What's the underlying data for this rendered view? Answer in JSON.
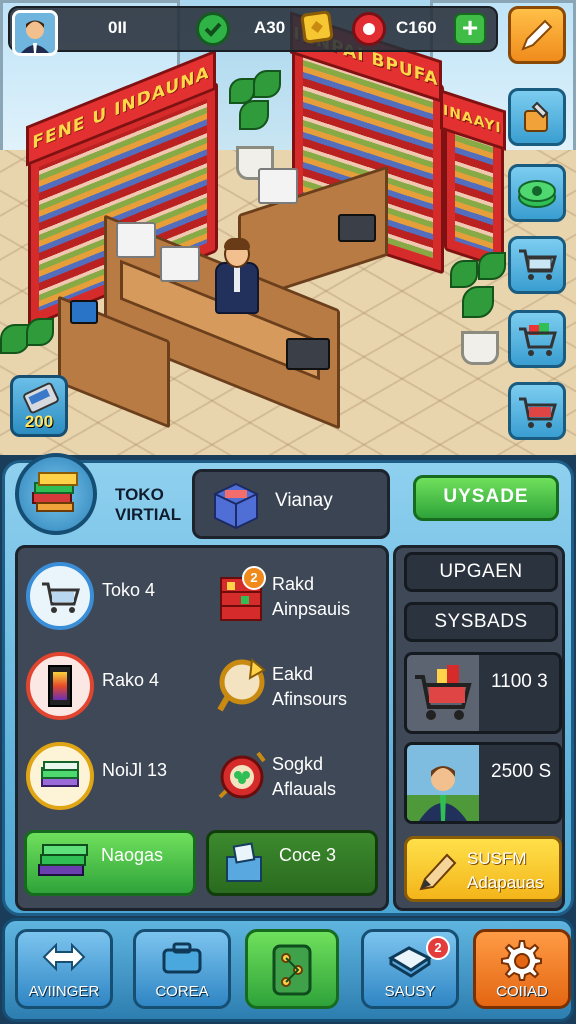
{
  "scene": {
    "signs": [
      "FENE U INDAUNA",
      "INNPAI BPUFA",
      "INAAYIF"
    ]
  },
  "topbar": {
    "resource1": "0II",
    "resource2": "A30",
    "resource3": "C160"
  },
  "left_item": {
    "count": "200"
  },
  "panel": {
    "store_title_line1": "TOKO",
    "store_title_line2": "VIRTIAL",
    "store_name": "Vianay",
    "upgrade_label": "UYSADE",
    "items": [
      {
        "label": "Toko 4"
      },
      {
        "label_line1": "Rakd",
        "label_line2": "Ainpsauis",
        "badge": "2"
      },
      {
        "label": "Rako 4"
      },
      {
        "label_line1": "Eakd",
        "label_line2": "Afinsours"
      },
      {
        "label": "NoiJl 13"
      },
      {
        "label_line1": "Sogkd",
        "label_line2": "Aflauals"
      }
    ],
    "button_left": "Naogas",
    "button_right": "Coce  3",
    "right": {
      "btn1": "UPGAEN",
      "btn2": "SYSBADS",
      "offer1_price": "1100  3",
      "offer2_price": "2500  S",
      "gold_line1": "SUSFM",
      "gold_line2": "Adapauas"
    }
  },
  "nav": {
    "items": [
      {
        "label": "AVIINGER"
      },
      {
        "label": "COREA"
      },
      {
        "label": ""
      },
      {
        "label": "SAUSY",
        "badge": "2"
      },
      {
        "label": "COIIAD"
      }
    ]
  },
  "colors": {
    "green": "#3fbd47",
    "red": "#d62b2b",
    "gold": "#f3b51a",
    "orange": "#f07a1e",
    "blue": "#3a9ed1"
  }
}
